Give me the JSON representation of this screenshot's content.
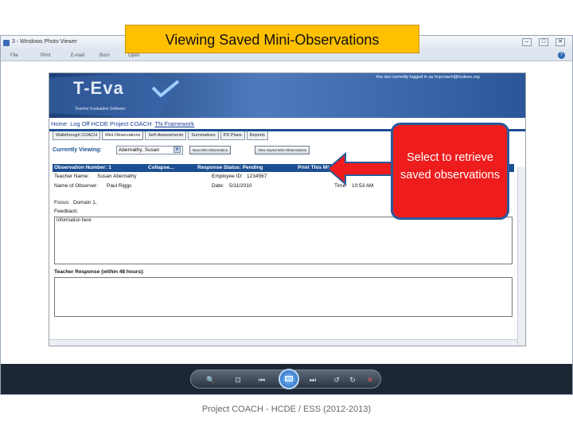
{
  "slide": {
    "title": "Viewing Saved Mini-Observations",
    "footer": "Project COACH - HCDE / ESS (2012-2013)",
    "callout": "Select to retrieve saved observations"
  },
  "viewer": {
    "title": "3 - Windows Photo Viewer",
    "menu": [
      "File",
      "Print",
      "E-mail",
      "Burn",
      "Open"
    ],
    "help": "?"
  },
  "webpage": {
    "logo": "T-Eva",
    "logo_subtitle": "Teacher Evaluation Software",
    "login_notice": "You are currently logged in as hcpcoach@hcdeoo.org",
    "nav": [
      "Home",
      "Log Off HCDE Project COACH",
      "TN Framework"
    ],
    "tabs": [
      "Walkthrough COACH",
      "Mini-Observations",
      "Self-Assessments",
      "Summatives",
      "PD Plans",
      "Reports"
    ],
    "viewing_label": "Currently Viewing:",
    "viewing_value": "Abernathy, Susan",
    "new_button": "New Mini-Observation",
    "view_saved_button": "View Saved Mini-Observations",
    "observation": {
      "number": "Observation Number: 1",
      "collapse": "Collapse...",
      "status": "Response Status: Pending",
      "print": "Print This Mini-Observation",
      "teacher_label": "Teacher Name:",
      "teacher_value": "Susan Abernathy",
      "employee_label": "Employee ID:",
      "employee_value": "1234567",
      "observer_label": "Name of Observer:",
      "observer_value": "Paul Riggs",
      "date_label": "Date:",
      "date_value": "5/11/2010",
      "time_label": "Time:",
      "time_value": "10:53 AM",
      "focus_label": "Focus:",
      "focus_value": "Domain 1,",
      "feedback_label": "Feedback:",
      "feedback_value": "Information here",
      "response_label": "Teacher Response (within 48 hours):"
    }
  },
  "colors": {
    "title_bg": "#ffc000",
    "callout_bg": "#ee1c1c",
    "callout_border": "#2a5a9c",
    "header_blue": "#1b4e92"
  }
}
